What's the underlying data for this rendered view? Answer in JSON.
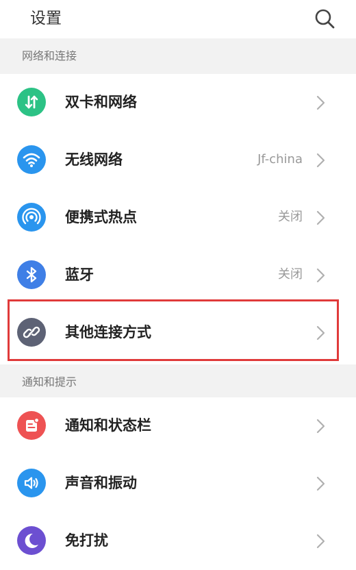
{
  "header": {
    "title": "设置"
  },
  "sections": [
    {
      "title": "网络和连接",
      "items": [
        {
          "label": "双卡和网络",
          "value": "",
          "icon": "dual-sim-icon",
          "color": "#2cc285"
        },
        {
          "label": "无线网络",
          "value": "Jf-china",
          "icon": "wifi-icon",
          "color": "#2a95ee"
        },
        {
          "label": "便携式热点",
          "value": "关闭",
          "icon": "hotspot-icon",
          "color": "#2a95ee"
        },
        {
          "label": "蓝牙",
          "value": "关闭",
          "icon": "bluetooth-icon",
          "color": "#3f7fe6"
        },
        {
          "label": "其他连接方式",
          "value": "",
          "icon": "link-icon",
          "color": "#5d6275",
          "highlighted": true
        }
      ]
    },
    {
      "title": "通知和提示",
      "items": [
        {
          "label": "通知和状态栏",
          "value": "",
          "icon": "notification-icon",
          "color": "#ee5253"
        },
        {
          "label": "声音和振动",
          "value": "",
          "icon": "sound-icon",
          "color": "#2a95ee"
        },
        {
          "label": "免打扰",
          "value": "",
          "icon": "moon-icon",
          "color": "#6c4fd1"
        }
      ]
    }
  ],
  "colors": {
    "highlight": "#e03a3a",
    "section_bg": "#f2f2f2",
    "chevron": "#b0b0b0"
  }
}
